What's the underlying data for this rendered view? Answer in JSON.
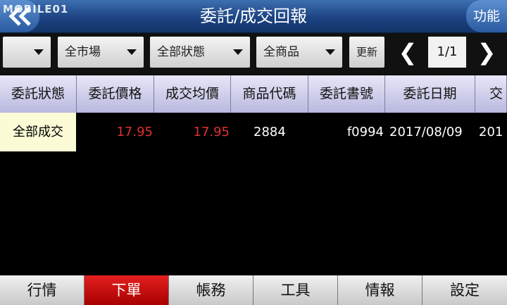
{
  "header": {
    "title": "委託/成交回報",
    "watermark": "MOBILE01",
    "function_label": "功能"
  },
  "filters": {
    "dd0": "",
    "market": "全市場",
    "status": "全部狀態",
    "product": "全商品",
    "refresh_label": "更新",
    "prev": "❮",
    "page": "1/1",
    "next": "❯"
  },
  "table": {
    "columns": [
      "委託狀態",
      "委託價格",
      "成交均價",
      "商品代碼",
      "委託書號",
      "委託日期",
      "交"
    ],
    "rows": [
      [
        "全部成交",
        "17.95",
        "17.95",
        "2884",
        "f0994",
        "2017/08/09",
        "201"
      ]
    ]
  },
  "tabs": [
    "行情",
    "下單",
    "帳務",
    "工具",
    "情報",
    "設定"
  ],
  "colors": {
    "accent_red": "#e03030",
    "active_tab": "#c00000",
    "title_bar": "#1c4382"
  }
}
